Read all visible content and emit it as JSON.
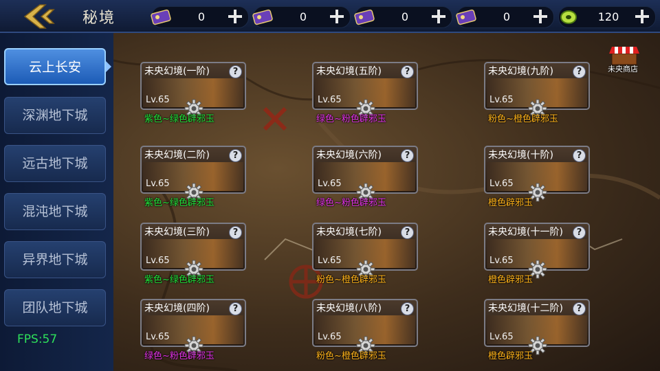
{
  "header": {
    "title": "秘境",
    "currencies": [
      {
        "icon": "purple-ticket-icon",
        "value": "0"
      },
      {
        "icon": "purple-ticket-icon",
        "value": "0"
      },
      {
        "icon": "purple-ticket-icon",
        "value": "0"
      },
      {
        "icon": "purple-ticket-icon",
        "value": "0"
      },
      {
        "icon": "jade-coin-icon",
        "value": "120"
      }
    ]
  },
  "sidebar": {
    "items": [
      {
        "label": "云上长安",
        "active": true
      },
      {
        "label": "深渊地下城"
      },
      {
        "label": "远古地下城"
      },
      {
        "label": "混沌地下城"
      },
      {
        "label": "异界地下城"
      },
      {
        "label": "团队地下城"
      }
    ]
  },
  "fps": "FPS:57",
  "shop": {
    "label": "未央商店",
    "icon": "shop-stall-icon"
  },
  "dungeons": [
    {
      "name": "未央幻境(一阶)",
      "level": "Lv.65",
      "reward": "紫色~绿色辟邪玉",
      "color": "#22e33a"
    },
    {
      "name": "未央幻境(二阶)",
      "level": "Lv.65",
      "reward": "紫色~绿色辟邪玉",
      "color": "#22e33a"
    },
    {
      "name": "未央幻境(三阶)",
      "level": "Lv.65",
      "reward": "紫色~绿色辟邪玉",
      "color": "#22e33a"
    },
    {
      "name": "未央幻境(四阶)",
      "level": "Lv.65",
      "reward": "绿色~粉色辟邪玉",
      "color": "#e233e6"
    },
    {
      "name": "未央幻境(五阶)",
      "level": "Lv.65",
      "reward": "绿色~粉色辟邪玉",
      "color": "#e233e6"
    },
    {
      "name": "未央幻境(六阶)",
      "level": "Lv.65",
      "reward": "绿色~粉色辟邪玉",
      "color": "#e233e6"
    },
    {
      "name": "未央幻境(七阶)",
      "level": "Lv.65",
      "reward": "粉色~橙色辟邪玉",
      "color": "#ffb31a"
    },
    {
      "name": "未央幻境(八阶)",
      "level": "Lv.65",
      "reward": "粉色~橙色辟邪玉",
      "color": "#ffb31a"
    },
    {
      "name": "未央幻境(九阶)",
      "level": "Lv.65",
      "reward": "粉色~橙色辟邪玉",
      "color": "#ffb31a"
    },
    {
      "name": "未央幻境(十阶)",
      "level": "Lv.65",
      "reward": "橙色辟邪玉",
      "color": "#ffb31a"
    },
    {
      "name": "未央幻境(十一阶)",
      "level": "Lv.65",
      "reward": "橙色辟邪玉",
      "color": "#ffb31a"
    },
    {
      "name": "未央幻境(十二阶)",
      "level": "Lv.65",
      "reward": "橙色辟邪玉",
      "color": "#ffb31a"
    }
  ]
}
